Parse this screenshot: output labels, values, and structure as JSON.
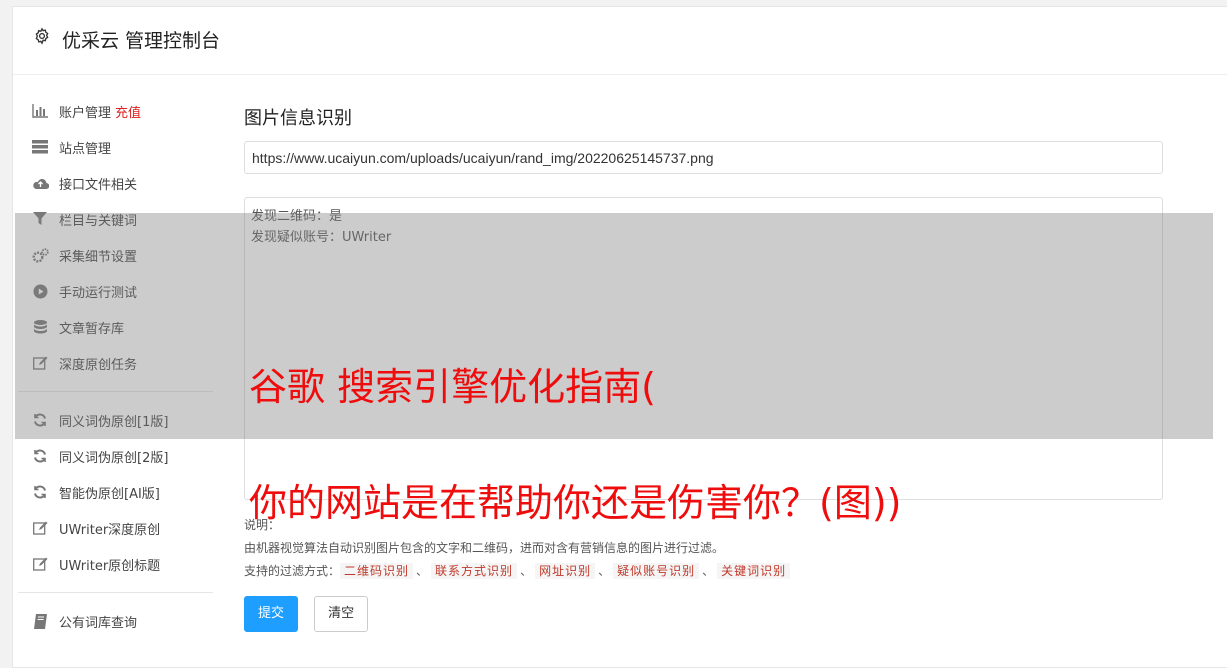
{
  "header": {
    "title": "优采云 管理控制台",
    "icon": "gear-icon"
  },
  "sidebar": {
    "items": [
      {
        "label": "账户管理",
        "badge": "充值",
        "icon": "bar-chart-icon"
      },
      {
        "label": "站点管理",
        "icon": "server-icon"
      },
      {
        "label": "接口文件相关",
        "icon": "cloud-upload-icon"
      },
      {
        "label": "栏目与关键词",
        "icon": "filter-icon"
      },
      {
        "label": "采集细节设置",
        "icon": "gears-icon"
      },
      {
        "label": "手动运行测试",
        "icon": "play-circle-icon"
      },
      {
        "label": "文章暂存库",
        "icon": "database-icon"
      },
      {
        "label": "深度原创任务",
        "icon": "edit-icon"
      },
      {
        "label": "同义词伪原创[1版]",
        "icon": "refresh-icon"
      },
      {
        "label": "同义词伪原创[2版]",
        "icon": "refresh-icon"
      },
      {
        "label": "智能伪原创[AI版]",
        "icon": "refresh-icon"
      },
      {
        "label": "UWriter深度原创",
        "icon": "edit-icon"
      },
      {
        "label": "UWriter原创标题",
        "icon": "edit-icon"
      },
      {
        "label": "公有词库查询",
        "icon": "book-icon"
      }
    ]
  },
  "main": {
    "heading": "图片信息识别",
    "url_value": "https://www.ucaiyun.com/uploads/ucaiyun/rand_img/20220625145737.png",
    "result_lines": [
      "发现二维码：是",
      "发现疑似账号：UWriter"
    ],
    "notes": {
      "label": "说明：",
      "description": "由机器视觉算法自动识别图片包含的文字和二维码，进而对含有营销信息的图片进行过滤。",
      "filter_prefix": "支持的过滤方式：",
      "filters": [
        "二维码识别",
        "联系方式识别",
        "网址识别",
        "疑似账号识别",
        "关键词识别"
      ],
      "separator": "、"
    },
    "submit_label": "提交",
    "clear_label": "清空"
  },
  "watermark": {
    "line1": "谷歌 搜索引擎优化指南(",
    "line2": "你的网站是在帮助你还是伤害你？(图))"
  },
  "colors": {
    "primary": "#1e9fff",
    "badge": "#e02020",
    "tag": "#c0392b",
    "watermark": "#ee0c0c"
  }
}
